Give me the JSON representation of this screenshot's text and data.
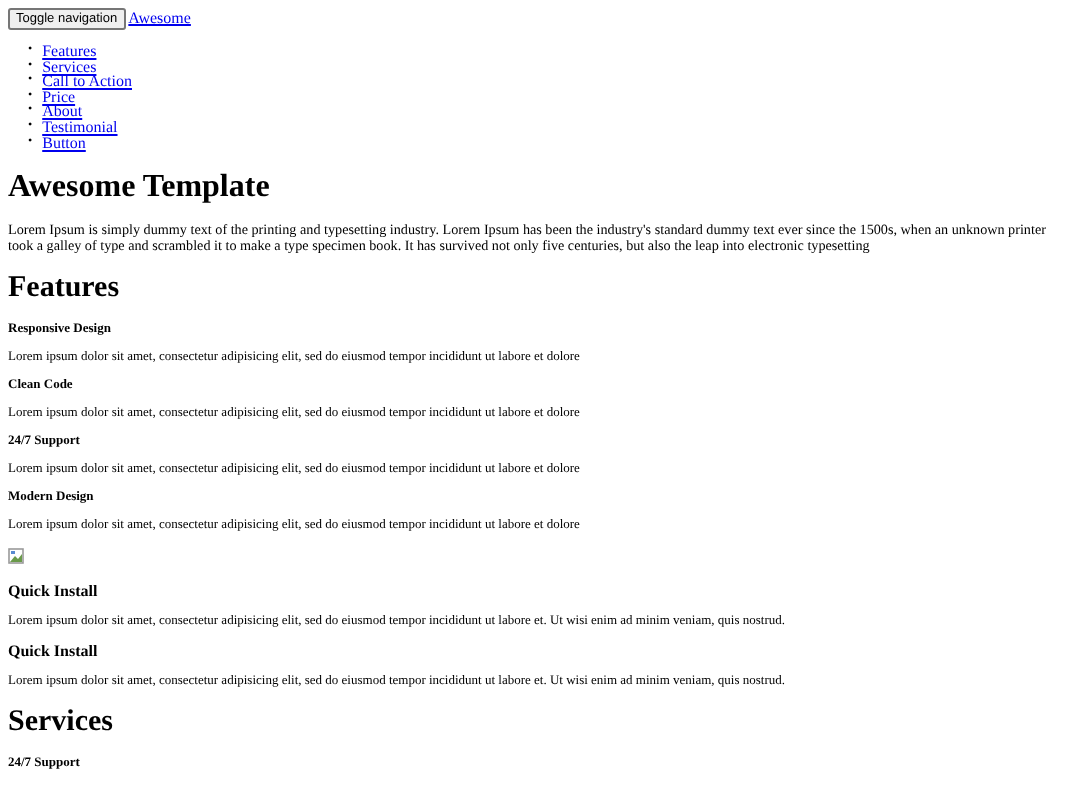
{
  "navbar": {
    "toggle_button": "Toggle navigation",
    "brand": "Awesome"
  },
  "menu": [
    {
      "marker": "•",
      "label": "Features"
    },
    {
      "marker": "•",
      "label": "Services"
    },
    {
      "marker": "•",
      "label": "Call to Action"
    },
    {
      "marker": "•",
      "label": "Price"
    },
    {
      "marker": "•",
      "label": "About"
    },
    {
      "marker": "•",
      "label": "Testimonial"
    },
    {
      "marker": "•",
      "label": "Button"
    }
  ],
  "hero": {
    "title": "Awesome Template",
    "text": "Lorem Ipsum is simply dummy text of the printing and typesetting industry. Lorem Ipsum has been the industry's standard dummy text ever since the 1500s, when an unknown printer took a galley of type and scrambled it to make a type specimen book. It has survived not only five centuries, but also the leap into electronic typesetting"
  },
  "sections": [
    {
      "title": "Features",
      "items": [
        {
          "kind": "feature",
          "heading": "Responsive Design",
          "text": "Lorem ipsum dolor sit amet, consectetur adipisicing elit, sed do eiusmod tempor incididunt ut labore et dolore"
        },
        {
          "kind": "feature",
          "heading": "Clean Code",
          "text": "Lorem ipsum dolor sit amet, consectetur adipisicing elit, sed do eiusmod tempor incididunt ut labore et dolore"
        },
        {
          "kind": "feature",
          "heading": "24/7 Support",
          "text": "Lorem ipsum dolor sit amet, consectetur adipisicing elit, sed do eiusmod tempor incididunt ut labore et dolore"
        },
        {
          "kind": "feature",
          "heading": "Modern Design",
          "text": "Lorem ipsum dolor sit amet, consectetur adipisicing elit, sed do eiusmod tempor incididunt ut labore et dolore"
        },
        {
          "kind": "image"
        },
        {
          "kind": "install",
          "heading": "Quick Install",
          "text": "Lorem ipsum dolor sit amet, consectetur adipisicing elit, sed do eiusmod tempor incididunt ut labore et. Ut wisi enim ad minim veniam, quis nostrud."
        },
        {
          "kind": "install",
          "heading": "Quick Install",
          "text": "Lorem ipsum dolor sit amet, consectetur adipisicing elit, sed do eiusmod tempor incididunt ut labore et. Ut wisi enim ad minim veniam, quis nostrud."
        }
      ]
    },
    {
      "title": "Services",
      "items": [
        {
          "kind": "feature",
          "heading": "24/7 Support"
        }
      ]
    }
  ]
}
